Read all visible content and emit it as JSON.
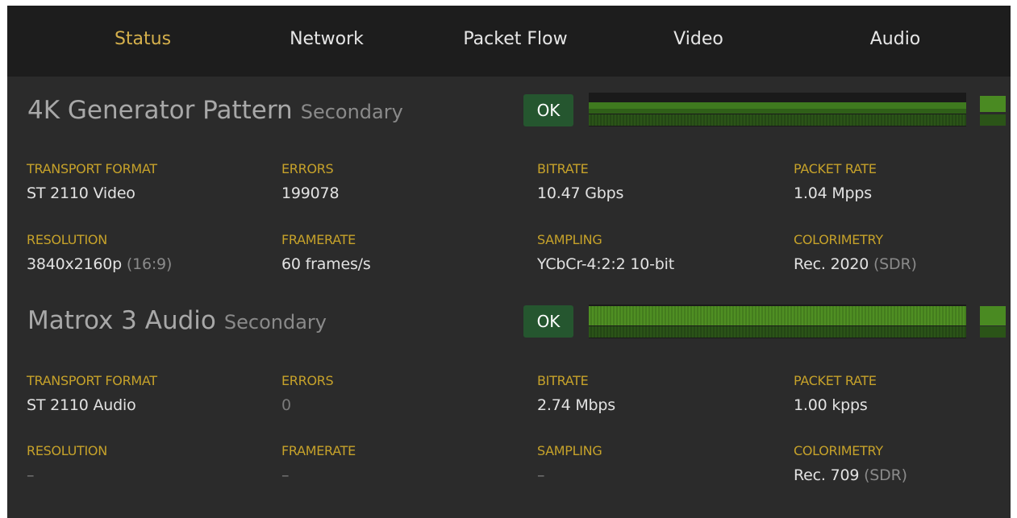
{
  "tabs": [
    {
      "label": "Status",
      "active": true
    },
    {
      "label": "Network",
      "active": false
    },
    {
      "label": "Packet Flow",
      "active": false
    },
    {
      "label": "Video",
      "active": false
    },
    {
      "label": "Audio",
      "active": false
    }
  ],
  "streams": [
    {
      "name": "4K Generator Pattern",
      "role": "Secondary",
      "status": "OK",
      "fields": {
        "transport_format": {
          "label": "TRANSPORT FORMAT",
          "value": "ST 2110 Video"
        },
        "errors": {
          "label": "ERRORS",
          "value": "199078"
        },
        "bitrate": {
          "label": "BITRATE",
          "value": "10.47 Gbps"
        },
        "packet_rate": {
          "label": "PACKET RATE",
          "value": "1.04 Mpps"
        },
        "resolution": {
          "label": "RESOLUTION",
          "value": "3840x2160p",
          "aside": "(16:9)"
        },
        "framerate": {
          "label": "FRAMERATE",
          "value": "60 frames/s"
        },
        "sampling": {
          "label": "SAMPLING",
          "value": "YCbCr-4:2:2 10-bit"
        },
        "colorimetry": {
          "label": "COLORIMETRY",
          "value": "Rec. 2020",
          "aside": "(SDR)"
        }
      }
    },
    {
      "name": "Matrox 3 Audio",
      "role": "Secondary",
      "status": "OK",
      "fields": {
        "transport_format": {
          "label": "TRANSPORT FORMAT",
          "value": "ST 2110 Audio"
        },
        "errors": {
          "label": "ERRORS",
          "value": "0"
        },
        "bitrate": {
          "label": "BITRATE",
          "value": "2.74 Mbps"
        },
        "packet_rate": {
          "label": "PACKET RATE",
          "value": "1.00 kpps"
        },
        "resolution": {
          "label": "RESOLUTION",
          "value": "–"
        },
        "framerate": {
          "label": "FRAMERATE",
          "value": "–"
        },
        "sampling": {
          "label": "SAMPLING",
          "value": "–"
        },
        "colorimetry": {
          "label": "COLORIMETRY",
          "value": "Rec. 709",
          "aside": "(SDR)"
        }
      }
    }
  ],
  "colors": {
    "active_tab": "#d5b04c",
    "label": "#c6a22a",
    "ok_badge": "#25562f",
    "meter_green": "#4a8a22"
  }
}
